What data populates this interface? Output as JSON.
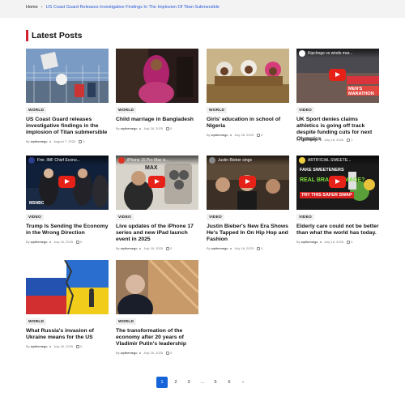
{
  "breadcrumb": {
    "home": "Home",
    "current": "US Coast Guard Releases Investigative Findings In The Implosion Of Titan Submersible"
  },
  "section_title": "Latest Posts",
  "posts": [
    {
      "badge": "WORLD",
      "title": "US Coast Guard releases investigative findings in the implosion of Titan submersible",
      "author": "wpthemego",
      "date": "August 7, 2025",
      "comments": "0"
    },
    {
      "badge": "WORLD",
      "title": "Child marriage in Bangladesh",
      "author": "wpthemego",
      "date": "July 26, 2025",
      "comments": "0"
    },
    {
      "badge": "WORLD",
      "title": "Girls' education in school of Nigeria",
      "author": "wpthemego",
      "date": "July 28, 2025",
      "comments": "0"
    },
    {
      "badge": "VIDEO",
      "title": "UK Sport denies claims athletics is going off track despite funding cuts for next Olympics",
      "author": "wpthemego",
      "date": "July 16, 2025",
      "comments": "1",
      "video_caption": "Kipchoge vs winds mar...",
      "overlay": "MEN'S MARATHON"
    },
    {
      "badge": "VIDEO",
      "title": "Trump Is Sending the Economy in the Wrong Direction",
      "author": "wpthemego",
      "date": "July 16, 2025",
      "comments": "0",
      "video_caption": "Fmr. IMF Chief Econo...",
      "overlay": "MSNBC"
    },
    {
      "badge": "VIDEO",
      "title": "Live updates of the iPhone 17 series and new iPad launch event in 2025",
      "author": "wpthemego",
      "date": "July 16, 2025",
      "comments": "0",
      "video_caption": "iPhone 15 Pro Max is...",
      "overlay": "MAX"
    },
    {
      "badge": "VIDEO",
      "title": "Justin Bieber's New Era Shows He's Tapped In On Hip Hop and Fashion",
      "author": "wpthemego",
      "date": "July 16, 2025",
      "comments": "0",
      "video_caption": "Justin Bieber sings"
    },
    {
      "badge": "VIDEO",
      "title": "Elderly care could not be better than what the world has today.",
      "author": "wpthemego",
      "date": "July 16, 2025",
      "comments": "0",
      "video_caption": "ARTIFICIAL SWEETE...",
      "overlay": "FAKE SWEETENERS",
      "overlay2": "REAL BRAIN DAMAGE?",
      "overlay3": "TRY THIS SAFER SWAP"
    },
    {
      "badge": "WORLD",
      "title": "What Russia's invasion of Ukraine means for the US",
      "author": "wpthemego",
      "date": "July 16, 2025",
      "comments": "0"
    },
    {
      "badge": "WORLD",
      "title": "The transformation of the economy after 20 years of Vladimir Putin's leadership",
      "author": "wpthemego",
      "date": "July 16, 2025",
      "comments": "0"
    }
  ],
  "pagination": {
    "pages": [
      "1",
      "2",
      "3",
      "...",
      "5",
      "6"
    ],
    "next": "›",
    "active": "1"
  },
  "colors": {
    "accent_red": "#d2222d",
    "link_blue": "#2a5bd7",
    "page_active": "#1565d8",
    "youtube_red": "#e62117"
  }
}
